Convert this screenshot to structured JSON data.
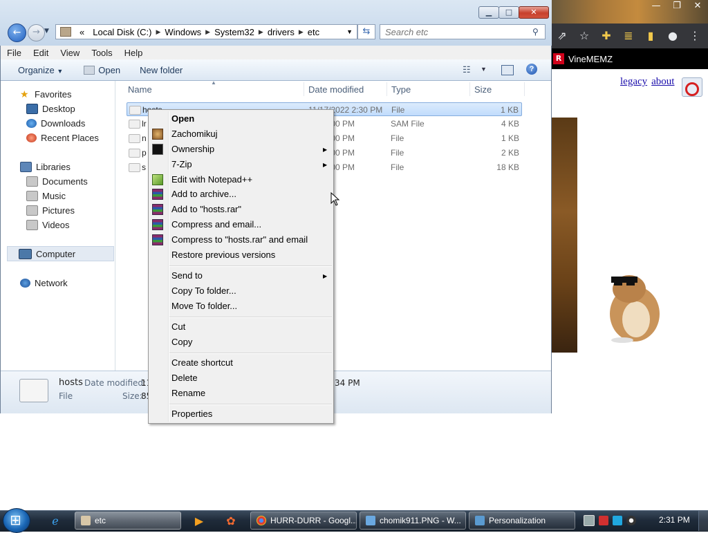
{
  "browser": {
    "bookmark_label": "VineMEMZ",
    "links": [
      "legacy",
      "about"
    ]
  },
  "explorer": {
    "window_buttons": [
      "minimize",
      "maximize",
      "close"
    ],
    "address": {
      "overflow": "«",
      "crumbs": [
        "Local Disk (C:)",
        "Windows",
        "System32",
        "drivers",
        "etc"
      ]
    },
    "search_placeholder": "Search etc",
    "menu": [
      "File",
      "Edit",
      "View",
      "Tools",
      "Help"
    ],
    "commands": {
      "organize": "Organize",
      "open": "Open",
      "new_folder": "New folder"
    },
    "nav": {
      "favorites": "Favorites",
      "desktop": "Desktop",
      "downloads": "Downloads",
      "recent": "Recent Places",
      "libraries": "Libraries",
      "documents": "Documents",
      "music": "Music",
      "pictures": "Pictures",
      "videos": "Videos",
      "computer": "Computer",
      "network": "Network"
    },
    "columns": {
      "name": "Name",
      "date": "Date modified",
      "type": "Type",
      "size": "Size"
    },
    "files": [
      {
        "name": "hosts",
        "date": "11/17/2022 2:30 PM",
        "type": "File",
        "size": "1 KB"
      },
      {
        "name": "lr",
        "date": "009 2:00 PM",
        "type": "SAM File",
        "size": "4 KB"
      },
      {
        "name": "n",
        "date": "009 2:00 PM",
        "type": "File",
        "size": "1 KB"
      },
      {
        "name": "p",
        "date": "009 2:00 PM",
        "type": "File",
        "size": "2 KB"
      },
      {
        "name": "s",
        "date": "009 2:00 PM",
        "type": "File",
        "size": "18 KB"
      }
    ],
    "details": {
      "name": "hosts",
      "type": "File",
      "modified_label": "Date modified:",
      "modified_value": "11",
      "size_label": "Size:",
      "size_value": "85",
      "tail": "34 PM"
    }
  },
  "context_menu": {
    "items": [
      "Open",
      "Zachomikuj",
      "Ownership",
      "7-Zip",
      "Edit with Notepad++",
      "Add to archive...",
      "Add to \"hosts.rar\"",
      "Compress and email...",
      "Compress to \"hosts.rar\" and email",
      "Restore previous versions",
      "Send to",
      "Copy To folder...",
      "Move To folder...",
      "Cut",
      "Copy",
      "Create shortcut",
      "Delete",
      "Rename",
      "Properties"
    ]
  },
  "taskbar": {
    "tasks": [
      "etc",
      "HURR-DURR - Googl...",
      "chomik911.PNG - W...",
      "Personalization"
    ],
    "clock": "2:31 PM"
  },
  "colors": {
    "menu_bg": "#f0f0f0",
    "selection": "#c1dcfc",
    "taskbar": "#1f2b3a",
    "browser_dark": "#202124"
  }
}
